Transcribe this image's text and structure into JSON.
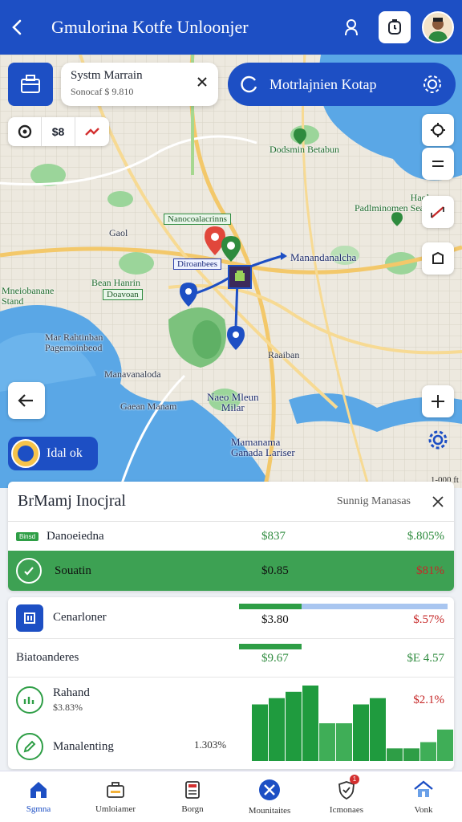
{
  "header": {
    "title": "Gmulorina Kotfe Unloonjer"
  },
  "search_card": {
    "title": "Systm Marrain",
    "subtitle": "Sonocaf $ 9.810"
  },
  "route_pill": {
    "label": "Motrlajnien Kotap"
  },
  "left_tools": [
    "",
    "$8",
    ""
  ],
  "map_labels": {
    "top_right_park": "Dodsmin Betabun",
    "haol": "Haol\nPadlminomen Sean",
    "tag_center": "Nanocoalacrinns",
    "gaol": "Gaol",
    "start_tag": "Diroanbees",
    "dest_label": "Manandanalcha",
    "left_west": "Mneiobanane\nStand",
    "left_mid": "Bean Hanrin",
    "left_tag": "Doavoan",
    "bay_left": "Mar Rahtinban\nPagemoinbeod",
    "bottom_left": "Manavanaloda",
    "south": "Gaean Manam",
    "southeast": "Raaiban",
    "center_south": "Naeo Mleun\nMilar",
    "bottom_center": "Mamanama\nGanada Lariser",
    "distance": "1-000 ft"
  },
  "ideal_pill": {
    "label": "Idal ok"
  },
  "summary_panel": {
    "title": "BrMamj Inocjral",
    "subtitle": "Sunnig Manasas",
    "row1": {
      "badge": "Binsd",
      "name": "Danoeiedna",
      "v1": "$837",
      "v2": "$.805%"
    },
    "row2": {
      "name": "Souatin",
      "v1": "$0.85",
      "v2": "$81%"
    }
  },
  "detail_panel": {
    "rows": [
      {
        "name": "Cenarloner",
        "v1": "$3.80",
        "v2": "$.57%"
      },
      {
        "name": "Biatoanderes",
        "v1": "$9.67",
        "v2": "$E 4.57"
      },
      {
        "name": "Rahand",
        "sub": "$3.83%",
        "v2": "$2.1%"
      },
      {
        "name": "Manalenting",
        "v1": "1.303%"
      }
    ]
  },
  "chart_data": {
    "type": "bar",
    "title": "",
    "categories": [
      "",
      "",
      "",
      "",
      "",
      "",
      "",
      "",
      "",
      "",
      "",
      ""
    ],
    "values": [
      9,
      10,
      11,
      12,
      6,
      6,
      9,
      10,
      2,
      2,
      3,
      5
    ],
    "ylim": [
      0,
      12
    ]
  },
  "bottom_nav": [
    {
      "label": "Sgmna",
      "icon": "home-icon",
      "active": true
    },
    {
      "label": "Umloiamer",
      "icon": "briefcase-icon"
    },
    {
      "label": "Borgn",
      "icon": "calculator-icon"
    },
    {
      "label": "Mounitaites",
      "icon": "tools-icon"
    },
    {
      "label": "Icmonaes",
      "icon": "shield-icon",
      "badge": "1"
    },
    {
      "label": "Vonk",
      "icon": "house-icon"
    }
  ],
  "colors": {
    "primary": "#1d4fc4",
    "green": "#2e9e46",
    "red": "#c62828"
  }
}
